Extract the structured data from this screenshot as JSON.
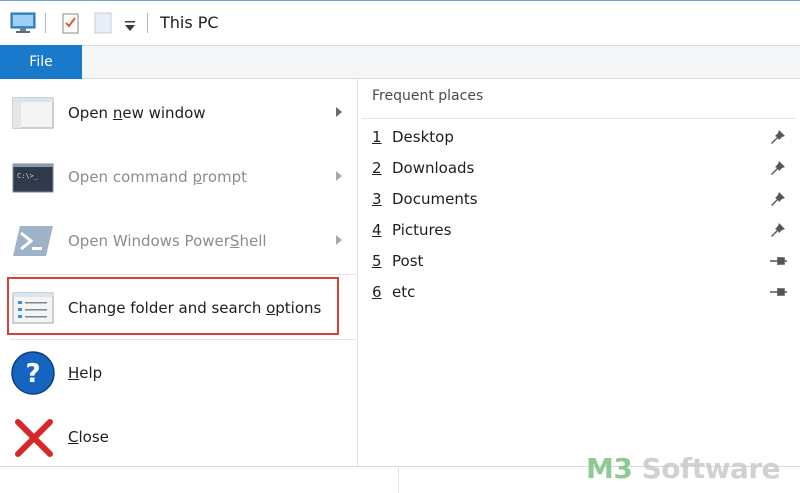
{
  "titlebar": {
    "title": "This PC",
    "icons": [
      "computer-icon",
      "properties-icon",
      "new-folder-icon",
      "customize-toolbar-icon"
    ]
  },
  "ribbon": {
    "file_tab": "File"
  },
  "menu": {
    "items": [
      {
        "label_pre": "Open ",
        "label_u": "n",
        "label_post": "ew window",
        "icon": "window-icon",
        "has_arrow": true,
        "disabled": false
      },
      {
        "label_pre": "Open command ",
        "label_u": "p",
        "label_post": "rompt",
        "icon": "cmd-icon",
        "has_arrow": true,
        "disabled": true
      },
      {
        "label_pre": "Open Windows Power",
        "label_u": "S",
        "label_post": "hell",
        "icon": "powershell-icon",
        "has_arrow": true,
        "disabled": true
      },
      {
        "label_pre": "Change folder and search ",
        "label_u": "o",
        "label_post": "ptions",
        "icon": "folder-options-icon",
        "has_arrow": false,
        "disabled": false,
        "highlighted": true
      },
      {
        "label_pre": "",
        "label_u": "H",
        "label_post": "elp",
        "icon": "help-icon",
        "has_arrow": false,
        "disabled": false
      },
      {
        "label_pre": "",
        "label_u": "C",
        "label_post": "lose",
        "icon": "close-icon",
        "has_arrow": false,
        "disabled": false
      }
    ]
  },
  "frequent_places": {
    "header": "Frequent places",
    "items": [
      {
        "num": "1",
        "name": "Desktop",
        "pinned": true
      },
      {
        "num": "2",
        "name": "Downloads",
        "pinned": true
      },
      {
        "num": "3",
        "name": "Documents",
        "pinned": true
      },
      {
        "num": "4",
        "name": "Pictures",
        "pinned": true
      },
      {
        "num": "5",
        "name": "Post",
        "pinned": false
      },
      {
        "num": "6",
        "name": "etc",
        "pinned": false
      }
    ]
  },
  "watermark": {
    "brand_a": "M3",
    "brand_b": " Software"
  },
  "colors": {
    "accent": "#1979ca",
    "highlight": "#d7423c"
  }
}
